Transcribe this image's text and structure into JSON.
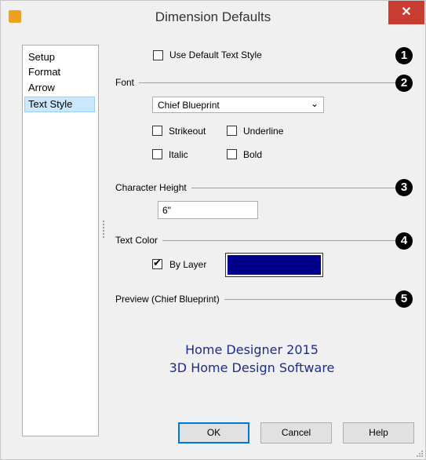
{
  "window": {
    "title": "Dimension Defaults",
    "close_label": "✕"
  },
  "nav": {
    "items": [
      {
        "label": "Setup"
      },
      {
        "label": "Format"
      },
      {
        "label": "Arrow"
      },
      {
        "label": "Text Style",
        "selected": true
      }
    ]
  },
  "use_default": {
    "label": "Use Default Text Style",
    "checked": false
  },
  "font": {
    "section": "Font",
    "selected": "Chief Blueprint",
    "strikeout": {
      "label": "Strikeout",
      "checked": false
    },
    "underline": {
      "label": "Underline",
      "checked": false
    },
    "italic": {
      "label": "Italic",
      "checked": false
    },
    "bold": {
      "label": "Bold",
      "checked": false
    }
  },
  "char_height": {
    "section": "Character Height",
    "value": "6\""
  },
  "text_color": {
    "section": "Text Color",
    "by_layer": {
      "label": "By Layer",
      "checked": true
    },
    "swatch_color": "#00008b"
  },
  "preview": {
    "section": "Preview (Chief Blueprint)",
    "line1": "Home Designer 2015",
    "line2": "3D Home Design Software"
  },
  "callouts": [
    "1",
    "2",
    "3",
    "4",
    "5"
  ],
  "buttons": {
    "ok": "OK",
    "cancel": "Cancel",
    "help": "Help"
  }
}
